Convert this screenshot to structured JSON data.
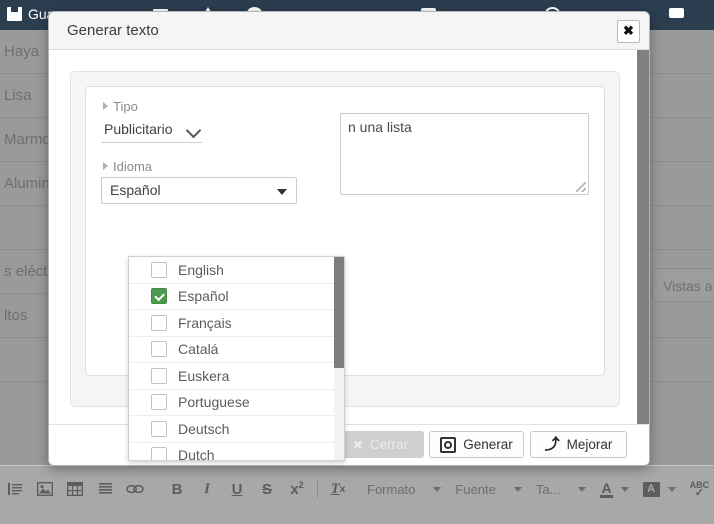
{
  "background": {
    "topbar": {
      "save_label": "Gua",
      "icons": [
        "save-icon",
        "play-icon",
        "cloud-icon",
        "layers-icon",
        "clock-icon",
        "window-icon"
      ]
    },
    "list_items": [
      {
        "label": "Haya"
      },
      {
        "label": "Lisa"
      },
      {
        "label": "Marmo"
      },
      {
        "label": "Alumin"
      },
      {
        "label": ""
      },
      {
        "label": "s eléctr"
      },
      {
        "label": "ltos"
      },
      {
        "label": ""
      }
    ],
    "vistas_button": "Vistas a"
  },
  "modal": {
    "title": "Generar texto",
    "close_icon": "✖",
    "form": {
      "tipo": {
        "label": "Tipo",
        "value": "Publicitario"
      },
      "idioma": {
        "label": "Idioma",
        "value": "Español",
        "options": [
          {
            "label": "English",
            "checked": false
          },
          {
            "label": "Español",
            "checked": true
          },
          {
            "label": "Français",
            "checked": false
          },
          {
            "label": "Catalá",
            "checked": false
          },
          {
            "label": "Euskera",
            "checked": false
          },
          {
            "label": "Portuguese",
            "checked": false
          },
          {
            "label": "Deutsch",
            "checked": false
          },
          {
            "label": "Dutch",
            "checked": false
          }
        ]
      },
      "prompt": {
        "value": "n una lista",
        "placeholder": ""
      }
    },
    "footer": {
      "cerrar": "Cerrar",
      "generar": "Generar",
      "mejorar": "Mejorar"
    }
  },
  "editor_toolbar": {
    "tools": [
      "source-icon",
      "image-icon",
      "table-icon",
      "justify-icon",
      "link-icon"
    ],
    "format_tools": [
      "B",
      "I",
      "U",
      "S",
      "x²"
    ],
    "remove_format": "Tx",
    "dropdowns": [
      {
        "label": "Formato"
      },
      {
        "label": "Fuente"
      },
      {
        "label": "Ta..."
      }
    ],
    "color_tools": [
      "text-color-icon",
      "background-color-icon",
      "spell-check-icon"
    ]
  }
}
